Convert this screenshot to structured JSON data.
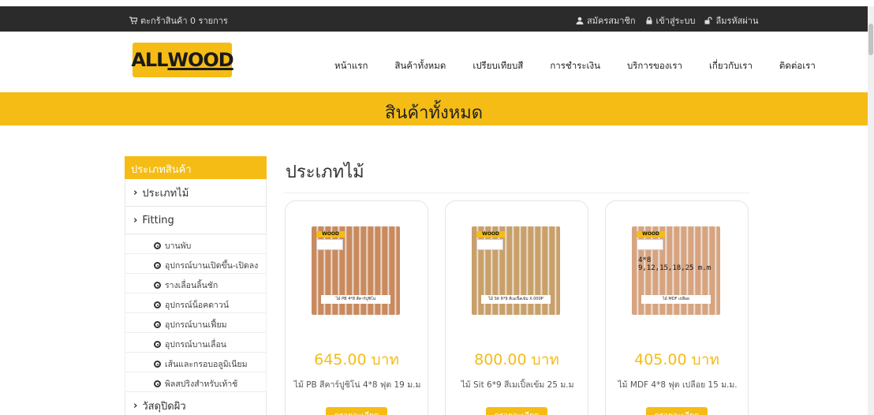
{
  "topbar": {
    "cart": "ตะกร้าสินค้า 0 รายการ",
    "register": "สมัครสมาชิก",
    "login": "เข้าสู่ระบบ",
    "forgot": "ลืมรหัสผ่าน"
  },
  "logo": {
    "text_a": "ALL",
    "text_b": "WOOD"
  },
  "nav": [
    "หน้าแรก",
    "สินค้าทั้งหมด",
    "เปรียบเทียบสี",
    "การชำระเงิน",
    "บริการของเรา",
    "เกี่ยวกับเรา",
    "ติดต่อเรา"
  ],
  "banner": {
    "title": "สินค้าทั้งหมด"
  },
  "sidebar": {
    "header": "ประเภทสินค้า",
    "cat_wood": "ประเภทไม้",
    "cat_fitting": "Fitting",
    "subitems": [
      "บานพับ",
      "อุปกรณ์บานเปิดขึ้น-เปิดลง",
      "รางเลื่อนลิ้นชัก",
      "อุปกรณ์น็อคดาวน์",
      "อุปกรณ์บานเฟี้ยม",
      "อุปกรณ์บานเลื่อน",
      "เส้นและกรอบอลูมิเนียม",
      "พิลสปริงสำหรับเท้าช้"
    ],
    "cat_last": "วัสดุปิดผิว"
  },
  "main": {
    "title": "ประเภทไม้"
  },
  "products": [
    {
      "price": "645.00 บาท",
      "name": "ไม้ PB สีคาร์ปูชิโน่ 4*8 ฟุต 19 ม.ม",
      "label": "ไม้ PB 4*8 สีคาร์ปูชิโน่",
      "wood": "#c98a5e",
      "button": "ดูรายละเอียด"
    },
    {
      "price": "800.00 บาท",
      "name": "ไม้ Sit 6*9 สีเมเปิ้ลเข้ม 25 ม.ม",
      "label": "ไม้ Sit 6*9 สีเมเปิ้ลเข้ม X.000P",
      "wood": "#c9a06a",
      "button": "ดูรายละเอียด"
    },
    {
      "price": "405.00 บาท",
      "name": "ไม้ MDF 4*8 ฟุต เปลือย 15 ม.ม.",
      "label": "ไม้ MDF เปลือย",
      "hand1": "4*8",
      "hand2": "9,12,15,18,25 m.m",
      "wood": "#d7a480",
      "button": "ดูรายละเอียด"
    }
  ],
  "colors": {
    "accent": "#f5bc16",
    "dark": "#2b2b2b"
  }
}
